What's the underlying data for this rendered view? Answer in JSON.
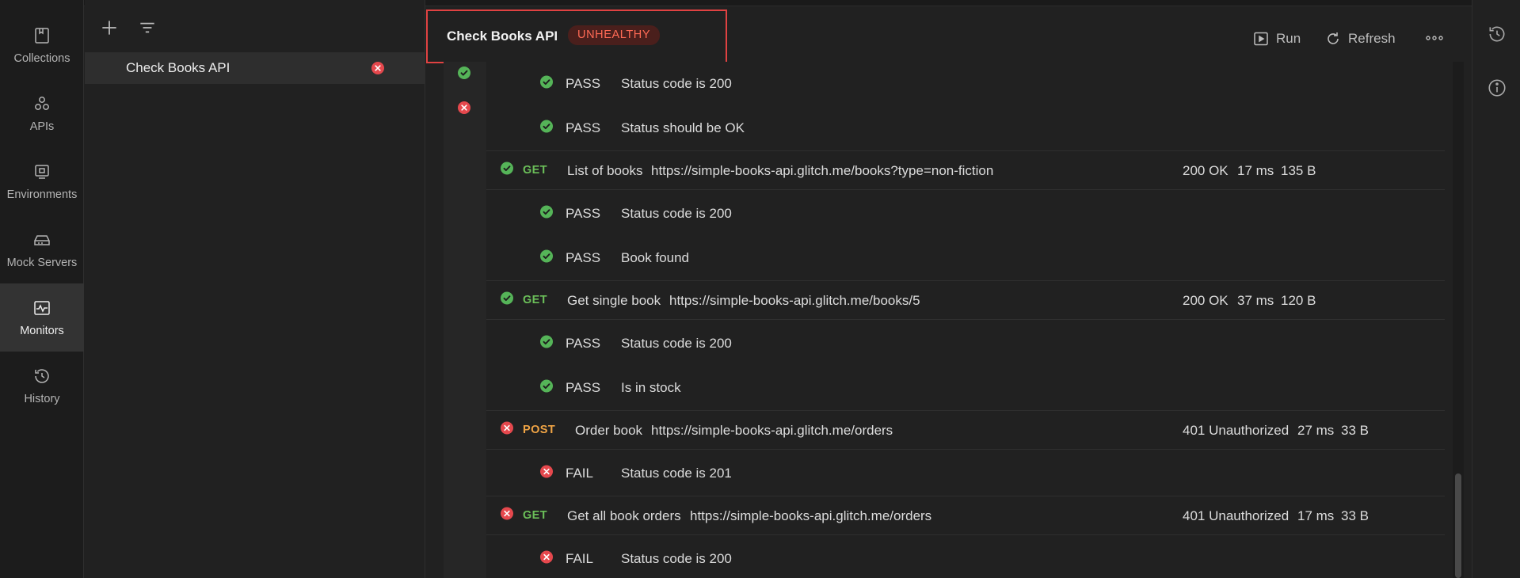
{
  "rail": {
    "items": [
      {
        "label": "Collections",
        "icon": "collections-icon"
      },
      {
        "label": "APIs",
        "icon": "apis-icon"
      },
      {
        "label": "Environments",
        "icon": "environments-icon"
      },
      {
        "label": "Mock Servers",
        "icon": "mock-servers-icon"
      },
      {
        "label": "Monitors",
        "icon": "monitors-icon",
        "active": true
      },
      {
        "label": "History",
        "icon": "history-icon"
      }
    ]
  },
  "sidebar": {
    "toolbar": {
      "add_icon": "plus-icon",
      "filter_icon": "filter-icon"
    },
    "monitors": [
      {
        "label": "Check Books API",
        "status": "failed"
      }
    ]
  },
  "header": {
    "title": "Check Books API",
    "health": "UNHEALTHY",
    "run_label": "Run",
    "refresh_label": "Refresh",
    "more_icon": "more-icon"
  },
  "colors": {
    "pass": "#55b458",
    "fail": "#e5484d",
    "get": "#6bbf59",
    "post": "#f0a445",
    "badge_text": "#ff6a55",
    "highlight_box": "#e04242"
  },
  "timeline": [
    {
      "status": "pass"
    },
    {
      "status": "fail"
    }
  ],
  "results": [
    {
      "kind": "test",
      "status": "pass",
      "outcome": "PASS",
      "name": "Status code is 200"
    },
    {
      "kind": "test",
      "status": "pass",
      "outcome": "PASS",
      "name": "Status should be OK"
    },
    {
      "kind": "request",
      "status": "pass",
      "method": "GET",
      "name": "List of books",
      "url": "https://simple-books-api.glitch.me/books?type=non-fiction",
      "code": "200 OK",
      "time": "17 ms",
      "size": "135 B"
    },
    {
      "kind": "test",
      "status": "pass",
      "outcome": "PASS",
      "name": "Status code is 200"
    },
    {
      "kind": "test",
      "status": "pass",
      "outcome": "PASS",
      "name": "Book found"
    },
    {
      "kind": "request",
      "status": "pass",
      "method": "GET",
      "name": "Get single book",
      "url": "https://simple-books-api.glitch.me/books/5",
      "code": "200 OK",
      "time": "37 ms",
      "size": "120 B"
    },
    {
      "kind": "test",
      "status": "pass",
      "outcome": "PASS",
      "name": "Status code is 200"
    },
    {
      "kind": "test",
      "status": "pass",
      "outcome": "PASS",
      "name": "Is in stock"
    },
    {
      "kind": "request",
      "status": "fail",
      "method": "POST",
      "name": "Order book",
      "url": "https://simple-books-api.glitch.me/orders",
      "code": "401 Unauthorized",
      "time": "27 ms",
      "size": "33 B"
    },
    {
      "kind": "test",
      "status": "fail",
      "outcome": "FAIL",
      "name": "Status code is 201"
    },
    {
      "kind": "request",
      "status": "fail",
      "method": "GET",
      "name": "Get all book orders",
      "url": "https://simple-books-api.glitch.me/orders",
      "code": "401 Unauthorized",
      "time": "17 ms",
      "size": "33 B"
    },
    {
      "kind": "test",
      "status": "fail",
      "outcome": "FAIL",
      "name": "Status code is 200"
    }
  ],
  "right_rail": {
    "icons": [
      "history-icon",
      "info-icon"
    ]
  }
}
